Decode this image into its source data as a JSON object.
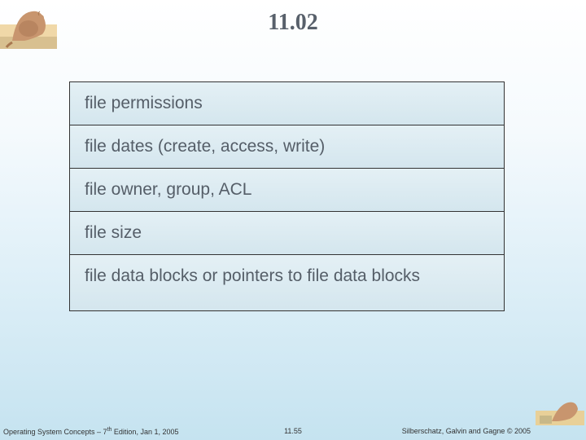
{
  "title": "11.02",
  "table": {
    "rows": [
      "file permissions",
      "file dates (create, access, write)",
      "file owner, group, ACL",
      "file size",
      "file data blocks or pointers to file data blocks"
    ]
  },
  "footer": {
    "left_prefix": "Operating System Concepts – 7",
    "left_super": "th",
    "left_suffix": " Edition, Jan 1, 2005",
    "center": "11.55",
    "right": "Silberschatz, Galvin and Gagne © 2005"
  }
}
